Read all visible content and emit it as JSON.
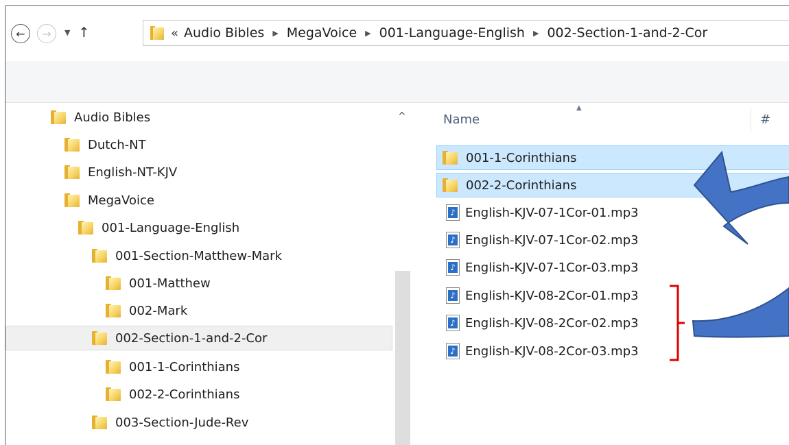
{
  "address": {
    "overflow_glyph": "«",
    "breadcrumbs": [
      "Audio Bibles",
      "MegaVoice",
      "001-Language-English",
      "002-Section-1-and-2-Cor"
    ]
  },
  "nav": {
    "back_glyph": "←",
    "forward_glyph": "→",
    "recent_glyph": "▼",
    "up_glyph": "↑"
  },
  "tree": {
    "scroll_up_glyph": "^",
    "items": [
      {
        "label": "Audio Bibles",
        "selected": false
      },
      {
        "label": "Dutch-NT",
        "selected": false
      },
      {
        "label": "English-NT-KJV",
        "selected": false
      },
      {
        "label": "MegaVoice",
        "selected": false
      },
      {
        "label": "001-Language-English",
        "selected": false
      },
      {
        "label": "001-Section-Matthew-Mark",
        "selected": false
      },
      {
        "label": "001-Matthew",
        "selected": false
      },
      {
        "label": "002-Mark",
        "selected": false
      },
      {
        "label": "002-Section-1-and-2-Cor",
        "selected": true
      },
      {
        "label": "001-1-Corinthians",
        "selected": false
      },
      {
        "label": "002-2-Corinthians",
        "selected": false
      },
      {
        "label": "003-Section-Jude-Rev",
        "selected": false
      }
    ]
  },
  "filelist": {
    "columns": {
      "name": "Name",
      "number": "#",
      "sort_glyph": "▲"
    },
    "rows": [
      {
        "name": "001-1-Corinthians",
        "type": "folder",
        "selected": true
      },
      {
        "name": "002-2-Corinthians",
        "type": "folder",
        "selected": true
      },
      {
        "name": "English-KJV-07-1Cor-01.mp3",
        "type": "audio",
        "selected": false
      },
      {
        "name": "English-KJV-07-1Cor-02.mp3",
        "type": "audio",
        "selected": false
      },
      {
        "name": "English-KJV-07-1Cor-03.mp3",
        "type": "audio",
        "selected": false
      },
      {
        "name": "English-KJV-08-2Cor-01.mp3",
        "type": "audio",
        "selected": false
      },
      {
        "name": "English-KJV-08-2Cor-02.mp3",
        "type": "audio",
        "selected": false
      },
      {
        "name": "English-KJV-08-2Cor-03.mp3",
        "type": "audio",
        "selected": false
      }
    ]
  },
  "colors": {
    "selection_fill": "#cce8ff",
    "selection_border": "#99d1ff",
    "annotation_arrow": "#4472c4",
    "annotation_bracket": "#e00000"
  }
}
